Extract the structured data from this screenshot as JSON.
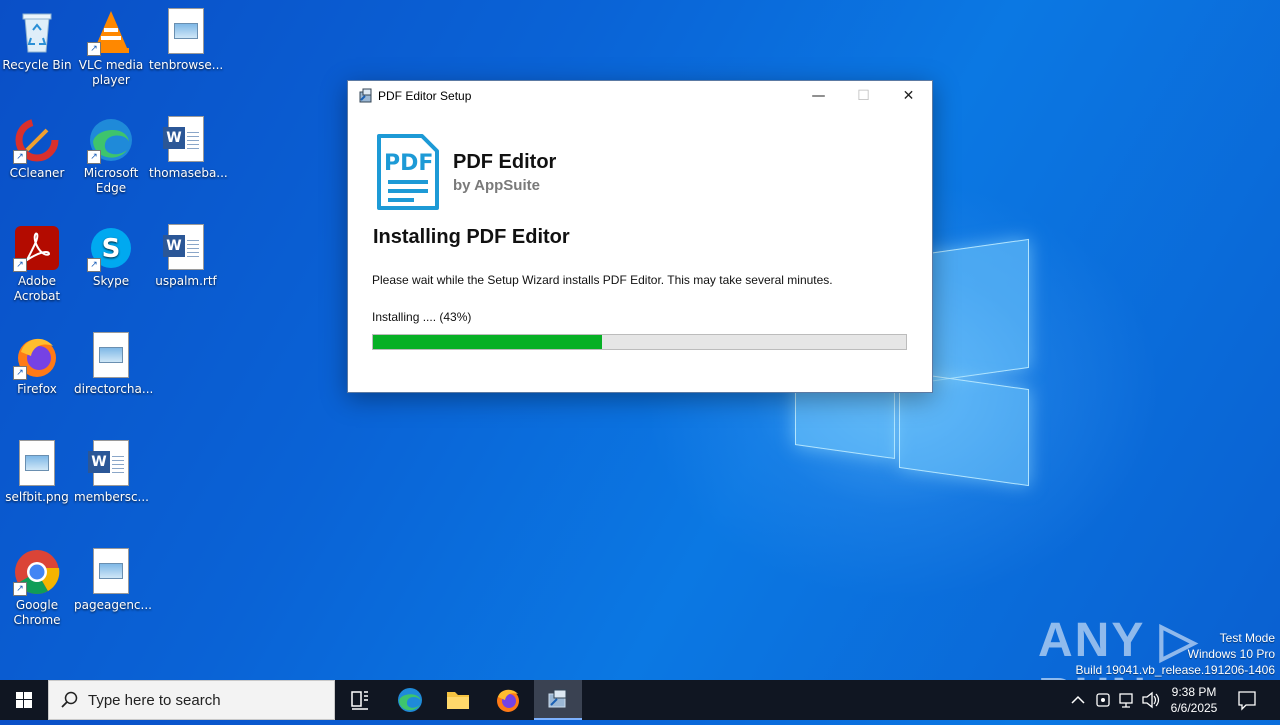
{
  "desktop": {
    "icons": [
      {
        "label": "Recycle Bin"
      },
      {
        "label": "VLC media player"
      },
      {
        "label": "tenbrowse..."
      },
      {
        "label": "CCleaner"
      },
      {
        "label": "Microsoft Edge"
      },
      {
        "label": "thomaseba..."
      },
      {
        "label": "Adobe Acrobat"
      },
      {
        "label": "Skype"
      },
      {
        "label": "uspalm.rtf"
      },
      {
        "label": "Firefox"
      },
      {
        "label": "directorcha..."
      },
      {
        "label": "selfbit.png"
      },
      {
        "label": "membersc..."
      },
      {
        "label": "Google Chrome"
      },
      {
        "label": "pageagenc..."
      }
    ]
  },
  "dialog": {
    "title": "PDF Editor Setup",
    "logo_text": "PDF",
    "app_name": "PDF Editor",
    "vendor": "by AppSuite",
    "heading": "Installing PDF Editor",
    "description": "Please wait while the Setup Wizard installs PDF Editor. This may take several minutes.",
    "status": "Installing .... (43%)",
    "progress_percent": 43,
    "progress_color": "#06b025"
  },
  "taskbar": {
    "search_placeholder": "Type here to search",
    "time": "9:38 PM",
    "date": "6/6/2025"
  },
  "watermark": {
    "line1": "Test Mode",
    "line2": "Windows 10 Pro",
    "line3": "Build 19041.vb_release.191206-1406",
    "brand": "ANY RUN"
  }
}
